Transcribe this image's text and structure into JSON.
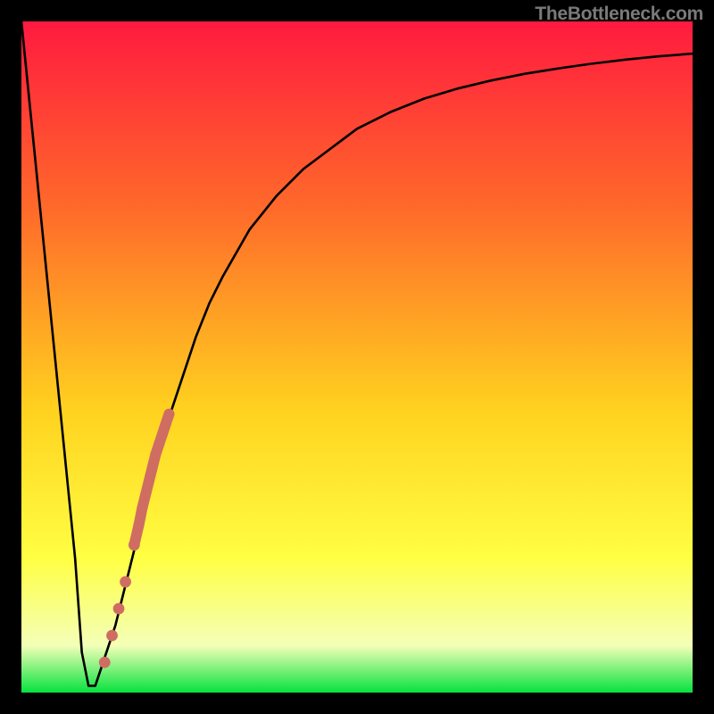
{
  "attribution": "TheBottleneck.com",
  "colors": {
    "frame": "#000000",
    "curve": "#000000",
    "markers": "#cf6d63",
    "gradient_top": "#ff1a3f",
    "gradient_mid1": "#ff6a2a",
    "gradient_mid2": "#ffd21f",
    "gradient_mid3": "#ffff43",
    "gradient_pale": "#f4ffb8",
    "gradient_bottom": "#06e23e"
  },
  "chart_data": {
    "type": "line",
    "title": "",
    "xlabel": "",
    "ylabel": "",
    "xlim": [
      0,
      100
    ],
    "ylim": [
      0,
      100
    ],
    "series": [
      {
        "name": "bottleneck-curve",
        "x": [
          0,
          2,
          4,
          6,
          8,
          9,
          10,
          11,
          12,
          14,
          16,
          18,
          20,
          22,
          24,
          26,
          28,
          30,
          34,
          38,
          42,
          46,
          50,
          55,
          60,
          65,
          70,
          75,
          80,
          85,
          90,
          95,
          100
        ],
        "y": [
          100,
          80,
          60,
          40,
          20,
          6,
          1,
          1,
          4,
          10,
          18,
          26,
          34,
          41,
          47,
          53,
          58,
          62,
          69,
          74,
          78,
          81,
          84,
          86.5,
          88.5,
          90,
          91.2,
          92.2,
          93,
          93.7,
          94.3,
          94.8,
          95.2
        ]
      }
    ],
    "markers": {
      "name": "highlighted-points",
      "points": [
        {
          "x": 12.4,
          "y": 4.5
        },
        {
          "x": 13.5,
          "y": 8.5
        },
        {
          "x": 14.5,
          "y": 12.5
        },
        {
          "x": 15.5,
          "y": 16.5
        },
        {
          "x": 16.8,
          "y": 22.0
        },
        {
          "x": 17.5,
          "y": 25.0
        },
        {
          "x": 18.0,
          "y": 27.5
        },
        {
          "x": 18.5,
          "y": 29.5
        },
        {
          "x": 19.0,
          "y": 31.5
        },
        {
          "x": 19.5,
          "y": 33.5
        },
        {
          "x": 20.0,
          "y": 35.5
        },
        {
          "x": 20.5,
          "y": 37.0
        },
        {
          "x": 21.0,
          "y": 38.5
        },
        {
          "x": 21.5,
          "y": 40.0
        },
        {
          "x": 22.0,
          "y": 41.5
        }
      ]
    }
  }
}
